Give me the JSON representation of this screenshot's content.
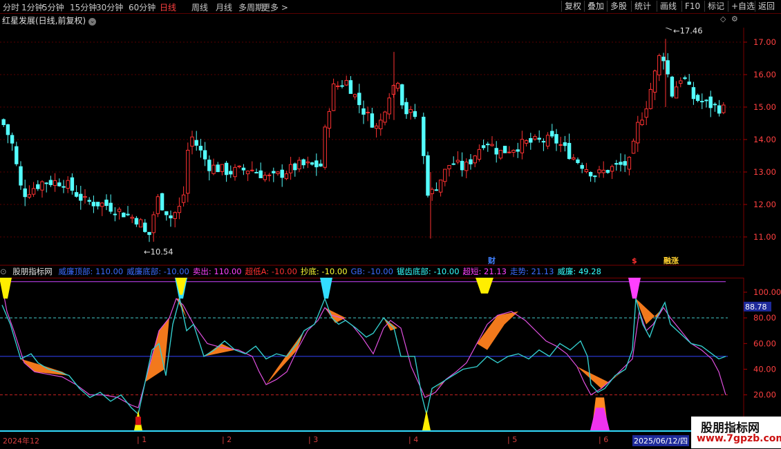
{
  "toolbar": {
    "periods": [
      "分时",
      "1分钟",
      "5分钟",
      "15分钟",
      "30分钟",
      "60分钟",
      "日线",
      "周线",
      "月线",
      "多周期",
      "更多 >"
    ],
    "active_period": "日线",
    "right_buttons": [
      "复权",
      "叠加",
      "多股",
      "统计",
      "画线",
      "F10",
      "标记",
      "+自选",
      "返回"
    ]
  },
  "stock_title": "红星发展(日线,前复权)",
  "main_chart": {
    "price_axis": [
      "17.00",
      "16.00",
      "15.00",
      "14.00",
      "13.00",
      "12.00",
      "11.00"
    ],
    "high_label": "17.46",
    "low_label": "10.54",
    "event_markers": [
      "财",
      "$",
      "融涨"
    ]
  },
  "indicator": {
    "name": "股朋指标网",
    "params": [
      {
        "text": "威廉顶部: 110.00",
        "color": "#3b6bff"
      },
      {
        "text": "威廉底部: -10.00",
        "color": "#3b6bff"
      },
      {
        "text": "卖出: 110.00",
        "color": "#ff40ff"
      },
      {
        "text": "超低A: -10.00",
        "color": "#ff3030"
      },
      {
        "text": "抄底: -10.00",
        "color": "#ffff33"
      },
      {
        "text": "GB: -10.00",
        "color": "#3b6bff"
      },
      {
        "text": "锯齿底部: -10.00",
        "color": "#33ffff"
      },
      {
        "text": "超短: 21.13",
        "color": "#ff40ff"
      },
      {
        "text": "走势: 21.13",
        "color": "#3b6bff"
      },
      {
        "text": "威廉: 49.28",
        "color": "#33ffff"
      }
    ],
    "axis_labels": [
      "100.00",
      "80.00",
      "60.00",
      "40.00",
      "20.00"
    ],
    "current_value": "88.78"
  },
  "date_axis": {
    "labels": [
      "2024年12",
      "1",
      "2",
      "3",
      "4",
      "5",
      "6"
    ],
    "selected_date": "2025/06/12/四"
  },
  "watermark": {
    "line1": "股朋指标网",
    "line2": "www.7gpzb.com"
  },
  "colors": {
    "up": "#ff3232",
    "down": "#54ffff",
    "accent_orange": "#ff7f1e",
    "grid": "#7a0000"
  }
}
